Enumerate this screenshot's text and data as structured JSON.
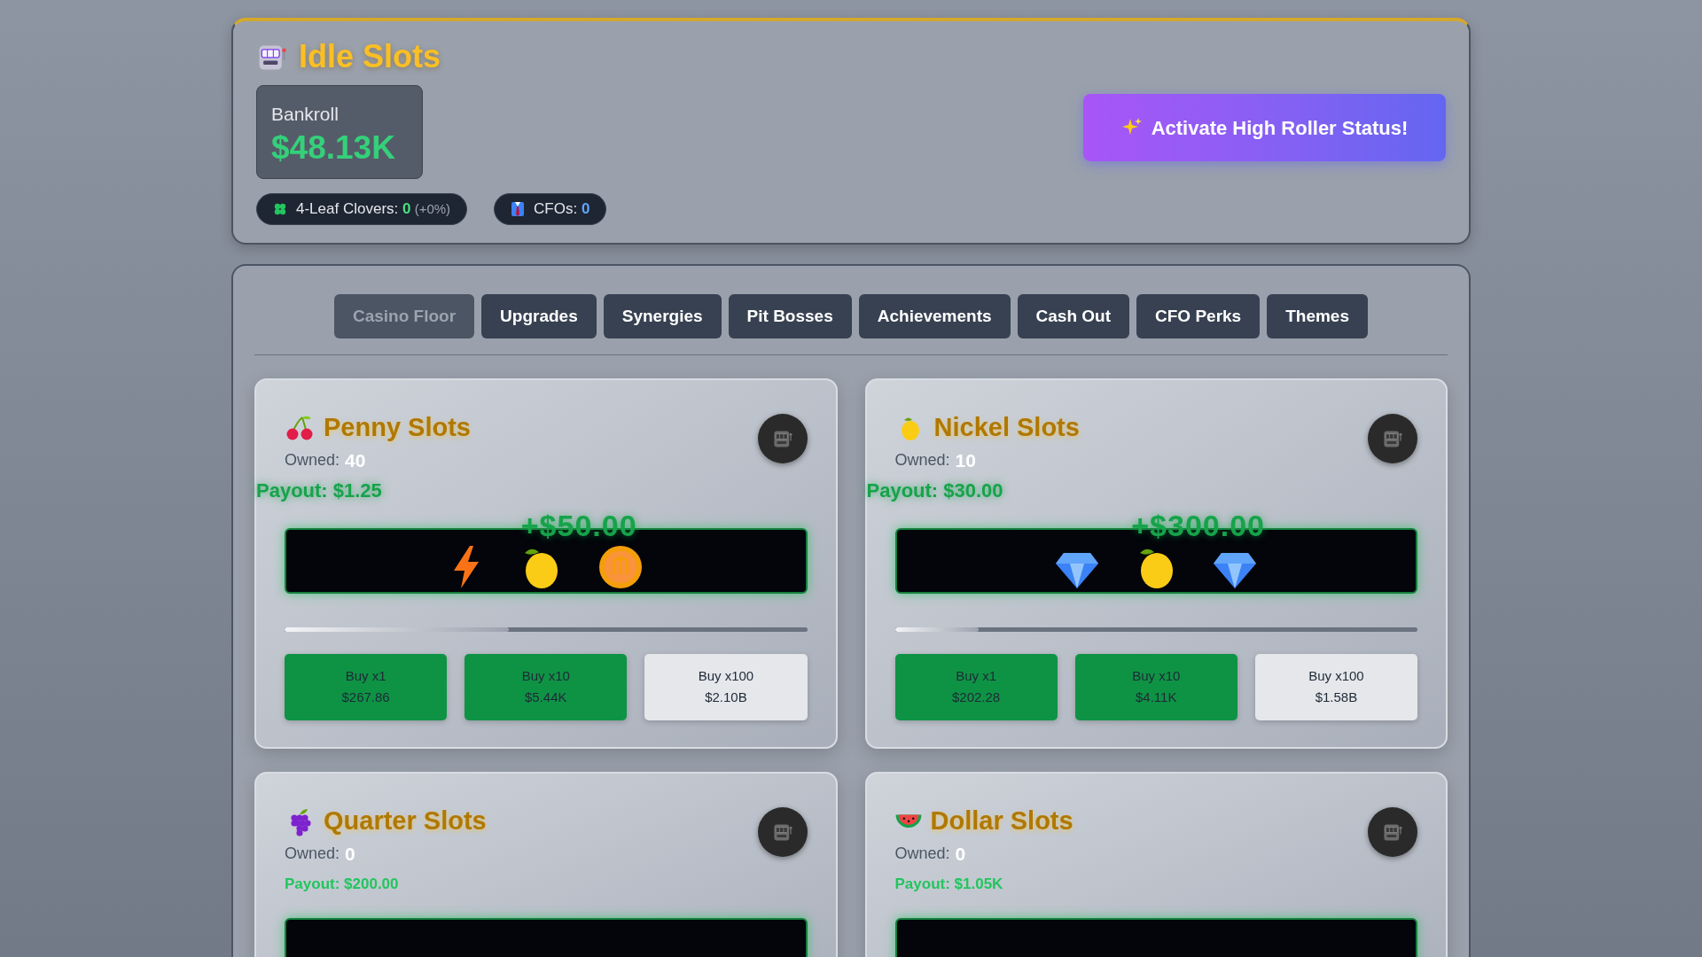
{
  "header": {
    "title": "Idle Slots",
    "bankroll": {
      "label": "Bankroll",
      "value": "$48.13K"
    },
    "badges": [
      {
        "kind": "clover",
        "label": "4-Leaf Clovers:",
        "value": "0",
        "extra": "(+0%)"
      },
      {
        "kind": "suit",
        "label": "CFOs:",
        "value": "0"
      }
    ],
    "action_button": "Activate High Roller Status!"
  },
  "tabs": [
    {
      "label": "Casino Floor",
      "selected": true
    },
    {
      "label": "Upgrades",
      "selected": false
    },
    {
      "label": "Synergies",
      "selected": false
    },
    {
      "label": "Pit Bosses",
      "selected": false
    },
    {
      "label": "Achievements",
      "selected": false
    },
    {
      "label": "Cash Out",
      "selected": false
    },
    {
      "label": "CFO Perks",
      "selected": false
    },
    {
      "label": "Themes",
      "selected": false
    }
  ],
  "machines": [
    {
      "name": "Penny Slots",
      "owned_label": "Owned:",
      "owned": "40",
      "payout": "Payout: $1.25",
      "flashing": true,
      "reel": {
        "symbols": [
          {
            "kind": "bolt"
          },
          {
            "kind": "lemon"
          },
          {
            "kind": "coin"
          }
        ],
        "win": "+$50.00"
      },
      "progress": {
        "level": 0.43
      },
      "buy_buttons": [
        {
          "label": "Buy x1",
          "cost": "$267.86",
          "affordable": true
        },
        {
          "label": "Buy x10",
          "cost": "$5.44K",
          "affordable": true
        },
        {
          "label": "Buy x100",
          "cost": "$2.10B",
          "affordable": false
        }
      ]
    },
    {
      "name": "Nickel Slots",
      "owned_label": "Owned:",
      "owned": "10",
      "payout": "Payout: $30.00",
      "flashing": true,
      "reel": {
        "symbols": [
          {
            "kind": "diamond"
          },
          {
            "kind": "lemon"
          },
          {
            "kind": "diamond"
          }
        ],
        "win": "+$300.00"
      },
      "progress": {
        "level": 0.16
      },
      "buy_buttons": [
        {
          "label": "Buy x1",
          "cost": "$202.28",
          "affordable": true
        },
        {
          "label": "Buy x10",
          "cost": "$4.11K",
          "affordable": true
        },
        {
          "label": "Buy x100",
          "cost": "$1.58B",
          "affordable": false
        }
      ]
    },
    {
      "name": "Quarter Slots",
      "owned_label": "Owned:",
      "owned": "0",
      "payout": "Payout: $200.00",
      "flashing": false
    },
    {
      "name": "Dollar Slots",
      "owned_label": "Owned:",
      "owned": "0",
      "payout": "Payout: $1.05K",
      "flashing": false
    }
  ]
}
